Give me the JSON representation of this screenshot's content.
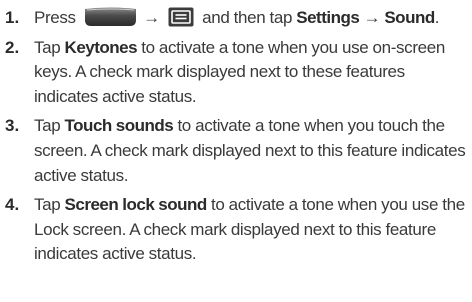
{
  "steps": [
    {
      "number": "1.",
      "press": "Press",
      "arrow1": "→",
      "and_then_tap": "and then tap",
      "settings": "Settings",
      "arrow2": "→",
      "sound": "Sound",
      "period": ".",
      "icons": [
        "home-key-icon",
        "menu-key-icon"
      ]
    },
    {
      "number": "2.",
      "tap": "Tap",
      "bold": "Keytones",
      "text": "to activate a tone when you use on-screen keys. A check mark displayed next to these features indicates active status."
    },
    {
      "number": "3.",
      "tap": "Tap",
      "bold": "Touch sounds",
      "text": "to activate a tone when you touch the screen. A check mark displayed next to this feature indicates active status."
    },
    {
      "number": "4.",
      "tap": "Tap",
      "bold": "Screen lock sound",
      "text": "to activate a tone when you use the Lock screen. A check mark displayed next to this feature indicates active status."
    }
  ],
  "colors": {
    "text": "#3a3a3a",
    "key_dark": "#3c3c3c",
    "key_light": "#9a9a9a"
  }
}
